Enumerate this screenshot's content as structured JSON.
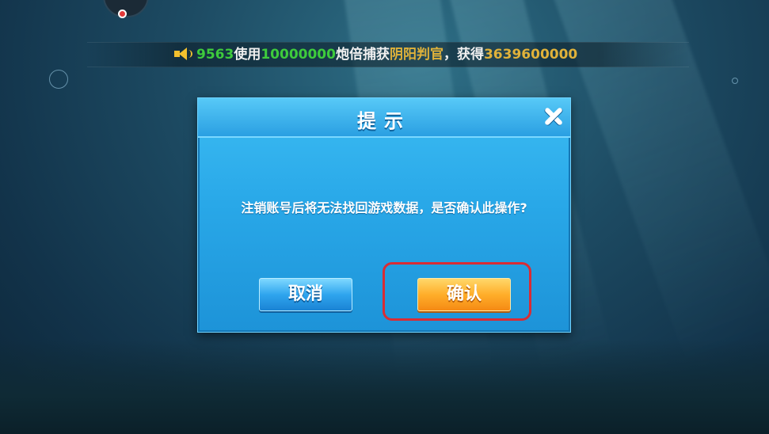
{
  "marquee": {
    "segments": [
      {
        "text": "9563",
        "color": "green"
      },
      {
        "text": "使用",
        "color": "white"
      },
      {
        "text": "10000000",
        "color": "green"
      },
      {
        "text": "炮倍捕获",
        "color": "white"
      },
      {
        "text": "阴阳判官",
        "color": "gold"
      },
      {
        "text": "，获得",
        "color": "white"
      },
      {
        "text": "3639600000",
        "color": "gold"
      }
    ]
  },
  "dialog": {
    "title": "提示",
    "message": "注销账号后将无法找回游戏数据，是否确认此操作?",
    "cancel_label": "取消",
    "confirm_label": "确认"
  },
  "colors": {
    "green": "#3ecb3c",
    "white": "#f0f0f0",
    "gold": "#e0b23a",
    "highlight": "#d92c34"
  }
}
